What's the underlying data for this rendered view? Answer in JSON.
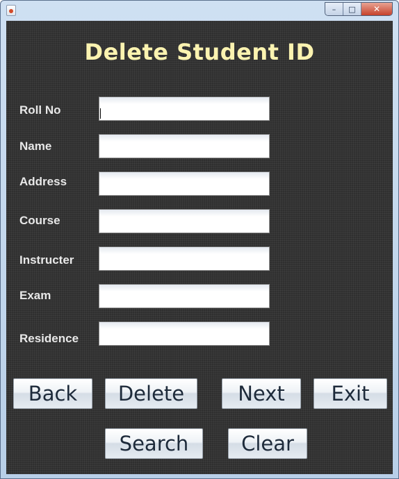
{
  "window": {
    "controls": {
      "minimize": "–",
      "maximize": "□",
      "close": "✕"
    },
    "app_icon": "java-cup-icon"
  },
  "form": {
    "heading": "Delete Student ID",
    "fields": [
      {
        "label": "Roll No",
        "value": ""
      },
      {
        "label": "Name",
        "value": ""
      },
      {
        "label": "Address",
        "value": ""
      },
      {
        "label": "Course",
        "value": ""
      },
      {
        "label": "Instructer",
        "value": ""
      },
      {
        "label": "Exam",
        "value": ""
      },
      {
        "label": "Residence",
        "value": ""
      }
    ]
  },
  "buttons": {
    "back": "Back",
    "delete": "Delete",
    "next": "Next",
    "exit": "Exit",
    "search": "Search",
    "clear": "Clear"
  },
  "colors": {
    "background": "#2f2f2f",
    "heading": "#fbf3b0",
    "label": "#e8e8e8"
  }
}
